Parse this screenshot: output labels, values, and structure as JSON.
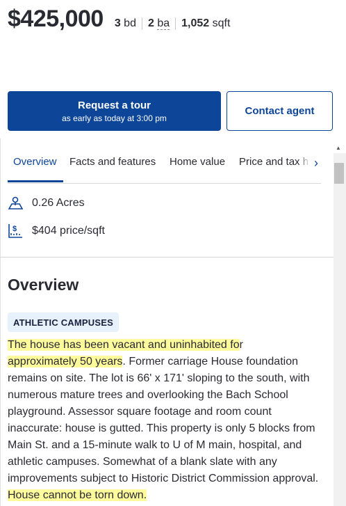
{
  "header": {
    "price": "$425,000",
    "beds_value": "3",
    "beds_unit": "bd",
    "baths_value": "2",
    "baths_unit": "ba",
    "sqft_value": "1,052",
    "sqft_unit": "sqft"
  },
  "actions": {
    "tour_label": "Request a tour",
    "tour_sublabel": "as early as today at 3:00 pm",
    "contact_label": "Contact agent"
  },
  "tabs": [
    {
      "label": "Overview",
      "active": true
    },
    {
      "label": "Facts and features",
      "active": false
    },
    {
      "label": "Home value",
      "active": false
    },
    {
      "label": "Price and tax h",
      "active": false
    }
  ],
  "facts": {
    "lot_size": "0.26 Acres",
    "price_per_sqft": "$404 price/sqft"
  },
  "overview": {
    "title": "Overview",
    "tag": "ATHLETIC CAMPUSES",
    "desc_hl1": "The house has been vacant and uninhabited fo",
    "desc_part1": "r",
    "desc_hl2": "approximately 50 years",
    "desc_part2": ". Former carriage House foundation remains on site. The lot is 66' x 171' sloping to the south, with numerous mature trees and overlooking the Bach School playground. Assessor square footage and room count inaccurate:  house is gutted.  This property is only 5 blocks from Main St. and a 15-minute walk to U of M main, hospital, and athletic campuses. Somewhat of a blank slate with any improvements subject to Historic District Commission approval. ",
    "desc_hl3": " House cannot be torn down. "
  },
  "colors": {
    "primary": "#0d4599",
    "highlight": "#fdfb9b",
    "tag_bg": "#e6f1fc"
  }
}
